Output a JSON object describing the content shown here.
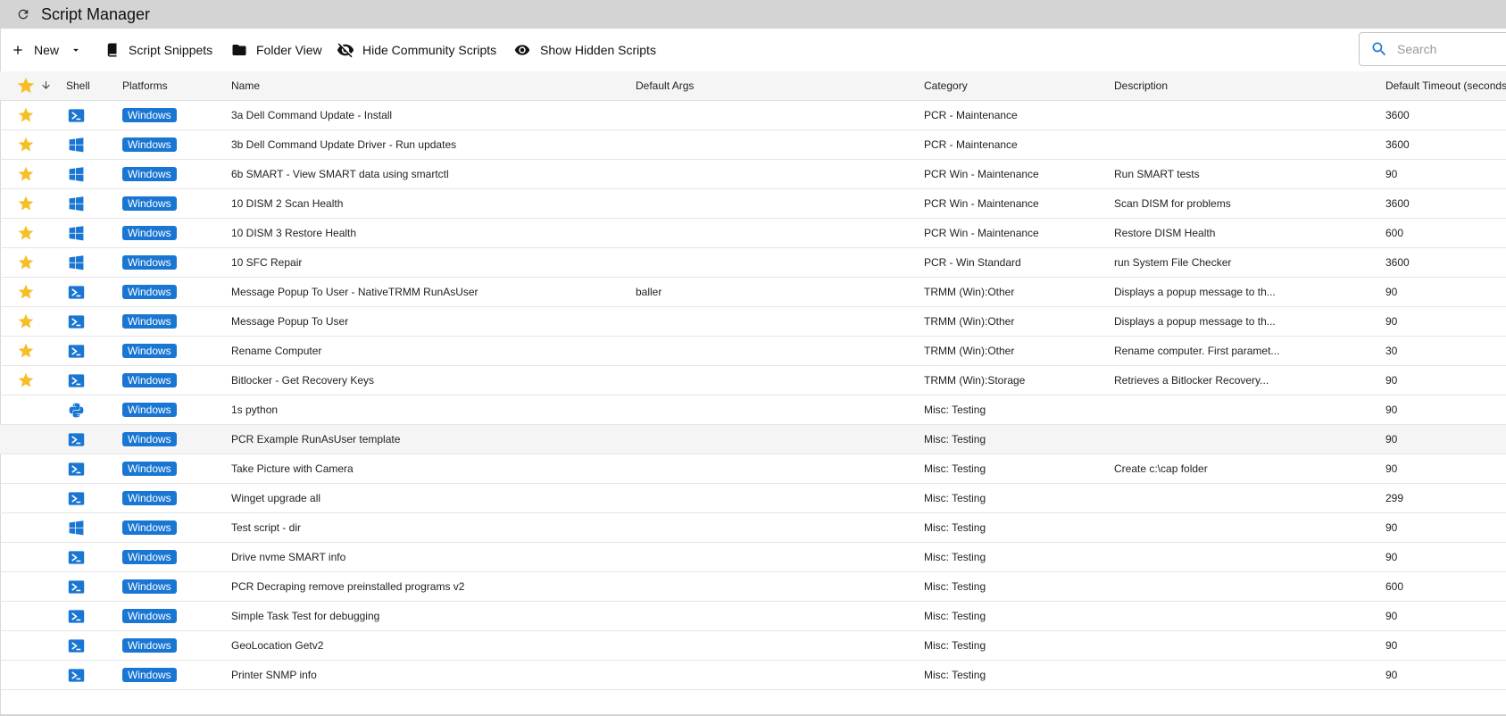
{
  "window": {
    "title": "Script Manager",
    "refresh_icon": "refresh-icon"
  },
  "toolbar": {
    "new_label": "New",
    "snippets_label": "Script Snippets",
    "folder_view_label": "Folder View",
    "hide_community_label": "Hide Community Scripts",
    "show_hidden_label": "Show Hidden Scripts"
  },
  "search": {
    "placeholder": "Search",
    "value": ""
  },
  "columns": {
    "shell": "Shell",
    "platforms": "Platforms",
    "name": "Name",
    "default_args": "Default Args",
    "category": "Category",
    "description": "Description",
    "default_timeout": "Default Timeout (seconds)"
  },
  "colors": {
    "accent": "#1976d2",
    "star": "#f6bf26",
    "header_bg": "#f5f5f5"
  },
  "rows": [
    {
      "favorite": true,
      "shell": "powershell",
      "platform": "Windows",
      "name": "3a Dell Command Update - Install",
      "args": "",
      "category": "PCR - Maintenance",
      "description": "",
      "timeout": "3600"
    },
    {
      "favorite": true,
      "shell": "cmd",
      "platform": "Windows",
      "name": "3b Dell Command Update Driver - Run updates",
      "args": "",
      "category": "PCR - Maintenance",
      "description": "",
      "timeout": "3600"
    },
    {
      "favorite": true,
      "shell": "cmd",
      "platform": "Windows",
      "name": "6b SMART - View SMART data using smartctl",
      "args": "",
      "category": "PCR Win - Maintenance",
      "description": "Run SMART tests",
      "timeout": "90"
    },
    {
      "favorite": true,
      "shell": "cmd",
      "platform": "Windows",
      "name": "10 DISM 2 Scan Health",
      "args": "",
      "category": "PCR Win - Maintenance",
      "description": "Scan DISM for problems",
      "timeout": "3600"
    },
    {
      "favorite": true,
      "shell": "cmd",
      "platform": "Windows",
      "name": "10 DISM 3 Restore Health",
      "args": "",
      "category": "PCR Win - Maintenance",
      "description": "Restore DISM Health",
      "timeout": "600"
    },
    {
      "favorite": true,
      "shell": "cmd",
      "platform": "Windows",
      "name": "10 SFC Repair",
      "args": "",
      "category": "PCR - Win Standard",
      "description": "run System File Checker",
      "timeout": "3600"
    },
    {
      "favorite": true,
      "shell": "powershell",
      "platform": "Windows",
      "name": "Message Popup To User - NativeTRMM RunAsUser",
      "args": "baller",
      "category": "TRMM (Win):Other",
      "description": "Displays a popup message to th...",
      "timeout": "90"
    },
    {
      "favorite": true,
      "shell": "powershell",
      "platform": "Windows",
      "name": "Message Popup To User",
      "args": "",
      "category": "TRMM (Win):Other",
      "description": "Displays a popup message to th...",
      "timeout": "90"
    },
    {
      "favorite": true,
      "shell": "powershell",
      "platform": "Windows",
      "name": "Rename Computer",
      "args": "",
      "category": "TRMM (Win):Other",
      "description": "Rename computer. First paramet...",
      "timeout": "30"
    },
    {
      "favorite": true,
      "shell": "powershell",
      "platform": "Windows",
      "name": "Bitlocker - Get Recovery Keys",
      "args": "",
      "category": "TRMM (Win):Storage",
      "description": "Retrieves a Bitlocker Recovery...",
      "timeout": "90"
    },
    {
      "favorite": false,
      "shell": "python",
      "platform": "Windows",
      "name": "1s python",
      "args": "",
      "category": "Misc: Testing",
      "description": "",
      "timeout": "90"
    },
    {
      "favorite": false,
      "shell": "powershell",
      "platform": "Windows",
      "name": "PCR Example RunAsUser template",
      "args": "",
      "category": "Misc: Testing",
      "description": "",
      "timeout": "90",
      "highlighted": true
    },
    {
      "favorite": false,
      "shell": "powershell",
      "platform": "Windows",
      "name": "Take Picture with Camera",
      "args": "",
      "category": "Misc: Testing",
      "description": "Create c:\\cap folder",
      "timeout": "90"
    },
    {
      "favorite": false,
      "shell": "powershell",
      "platform": "Windows",
      "name": "Winget upgrade all",
      "args": "",
      "category": "Misc: Testing",
      "description": "",
      "timeout": "299"
    },
    {
      "favorite": false,
      "shell": "cmd",
      "platform": "Windows",
      "name": "Test script - dir",
      "args": "",
      "category": "Misc: Testing",
      "description": "",
      "timeout": "90"
    },
    {
      "favorite": false,
      "shell": "powershell",
      "platform": "Windows",
      "name": "Drive nvme SMART info",
      "args": "",
      "category": "Misc: Testing",
      "description": "",
      "timeout": "90"
    },
    {
      "favorite": false,
      "shell": "powershell",
      "platform": "Windows",
      "name": "PCR Decraping remove preinstalled programs v2",
      "args": "",
      "category": "Misc: Testing",
      "description": "",
      "timeout": "600"
    },
    {
      "favorite": false,
      "shell": "powershell",
      "platform": "Windows",
      "name": "Simple Task Test for debugging",
      "args": "",
      "category": "Misc: Testing",
      "description": "",
      "timeout": "90"
    },
    {
      "favorite": false,
      "shell": "powershell",
      "platform": "Windows",
      "name": "GeoLocation Getv2",
      "args": "",
      "category": "Misc: Testing",
      "description": "",
      "timeout": "90"
    },
    {
      "favorite": false,
      "shell": "powershell",
      "platform": "Windows",
      "name": "Printer SNMP info",
      "args": "",
      "category": "Misc: Testing",
      "description": "",
      "timeout": "90"
    }
  ]
}
